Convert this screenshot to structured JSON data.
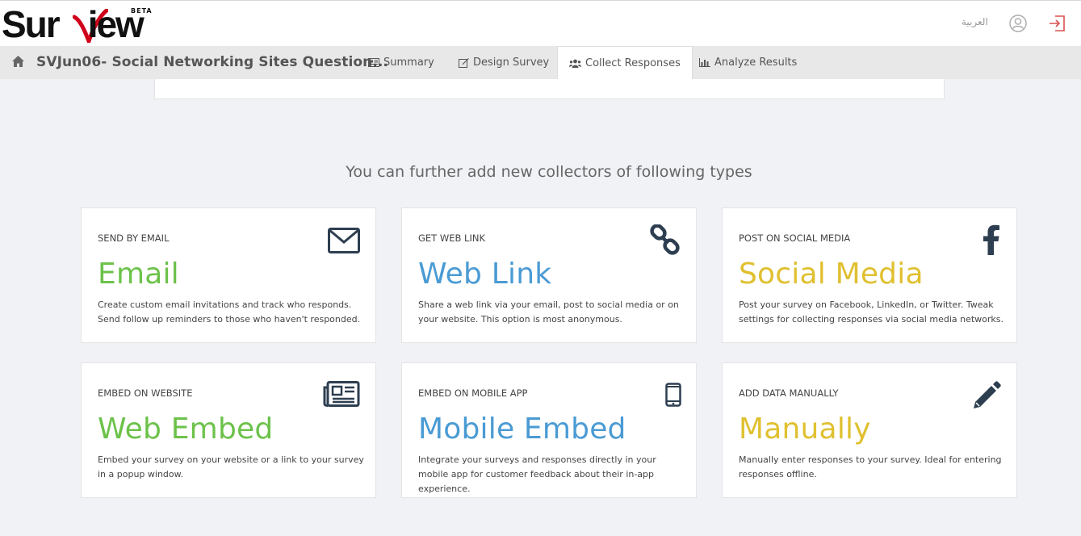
{
  "brand": {
    "logo_text": "Surview",
    "beta": "BETA"
  },
  "header": {
    "language": "العربية"
  },
  "nav": {
    "survey_title": "SVJun06- Social Networking Sites Question...",
    "tabs": [
      {
        "label": "Summary",
        "icon": "summary-icon"
      },
      {
        "label": "Design Survey",
        "icon": "edit-icon"
      },
      {
        "label": "Collect Responses",
        "icon": "users-icon",
        "active": true
      },
      {
        "label": "Analyze Results",
        "icon": "bar-chart-icon"
      }
    ]
  },
  "main": {
    "heading": "You can further add new collectors of following types",
    "collectors": [
      {
        "kicker": "SEND BY EMAIL",
        "title": "Email",
        "desc": "Create custom email invitations and track who responds. Send follow up reminders to those who haven't responded.",
        "icon": "envelope-icon",
        "color": "#6cc24a"
      },
      {
        "kicker": "GET WEB LINK",
        "title": "Web Link",
        "desc": "Share a web link via your email, post to social media or on your website. This option is most anonymous.",
        "icon": "link-icon",
        "color": "#4a9bd4"
      },
      {
        "kicker": "POST ON SOCIAL MEDIA",
        "title": "Social Media",
        "desc": "Post your survey on Facebook, LinkedIn, or Twitter. Tweak settings for collecting responses via social media networks.",
        "icon": "facebook-icon",
        "color": "#e0c030"
      },
      {
        "kicker": "EMBED ON WEBSITE",
        "title": "Web Embed",
        "desc": "Embed your survey on your website or a link to your survey in a popup window.",
        "icon": "newspaper-icon",
        "color": "#6cc24a"
      },
      {
        "kicker": "EMBED ON MOBILE APP",
        "title": "Mobile Embed",
        "desc": "Integrate your surveys and responses directly in your mobile app for customer feedback about their in-app experience.",
        "icon": "mobile-icon",
        "color": "#4a9bd4"
      },
      {
        "kicker": "ADD DATA MANUALLY",
        "title": "Manually",
        "desc": "Manually enter responses to your survey. Ideal for entering responses offline.",
        "icon": "pencil-icon",
        "color": "#e0c030"
      }
    ]
  }
}
